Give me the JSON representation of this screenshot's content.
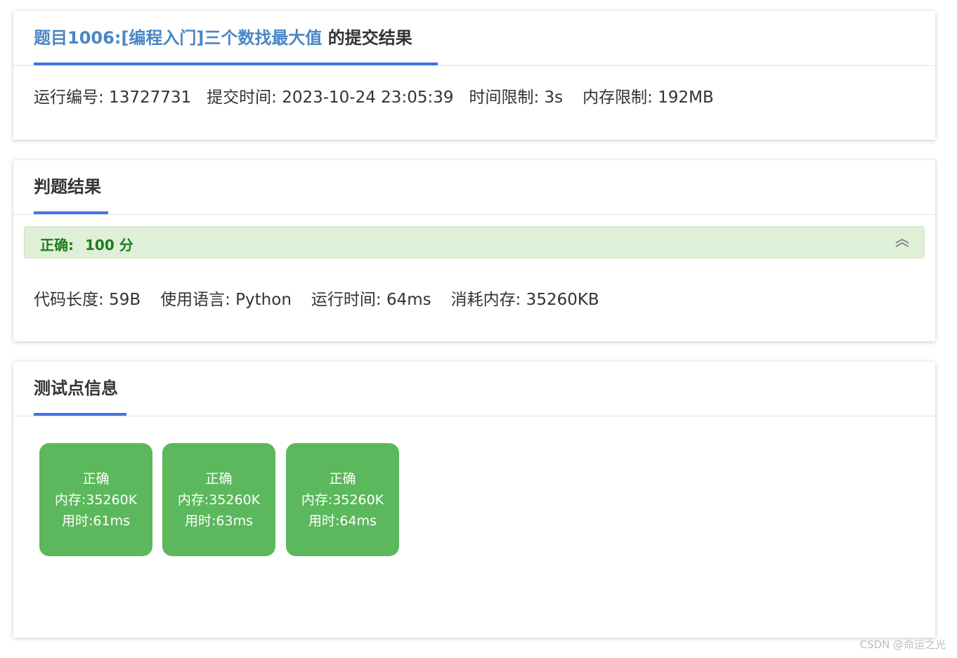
{
  "submission": {
    "title_link": "题目1006:[编程入门]三个数找最大值",
    "title_suffix": " 的提交结果",
    "run_id": "运行编号: 13727731",
    "submit_time": "提交时间: 2023-10-24 23:05:39",
    "time_limit": "时间限制: 3s",
    "memory_limit": "内存限制: 192MB"
  },
  "judge": {
    "heading": "判题结果",
    "status": "正确:",
    "score": "100 分",
    "code_length": "代码长度: 59B",
    "language": "使用语言: Python",
    "run_time": "运行时间: 64ms",
    "memory_used": "消耗内存: 35260KB"
  },
  "tests": {
    "heading": "测试点信息",
    "items": [
      {
        "status": "正确",
        "memory": "内存:35260K",
        "time": "用时:61ms"
      },
      {
        "status": "正确",
        "memory": "内存:35260K",
        "time": "用时:63ms"
      },
      {
        "status": "正确",
        "memory": "内存:35260K",
        "time": "用时:64ms"
      }
    ]
  },
  "watermark": "CSDN @命运之光",
  "colors": {
    "accent": "#4472e6",
    "link": "#4a86c5",
    "success_bg": "#dff0d8",
    "success_text": "#1e7d1e",
    "test_box": "#5cb85c"
  },
  "icons": {
    "collapse": "chevron-double-up-icon"
  }
}
